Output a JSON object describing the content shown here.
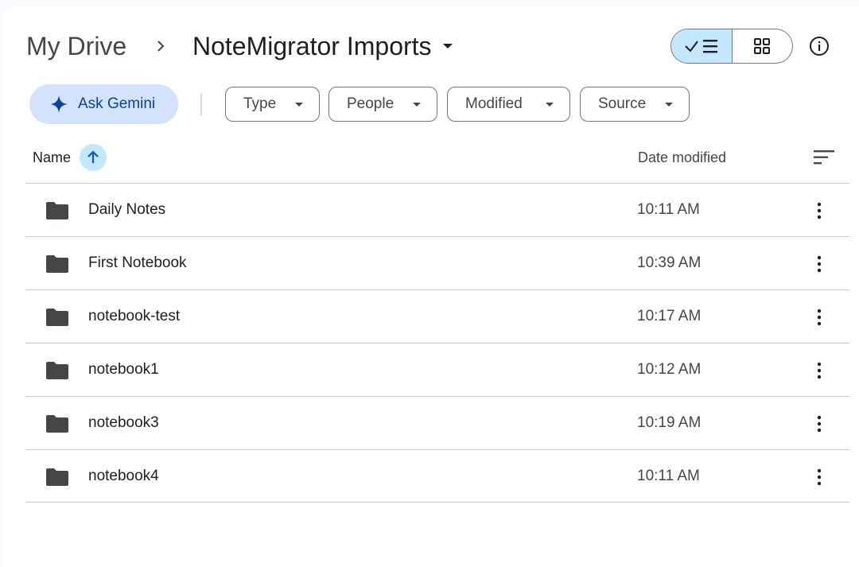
{
  "breadcrumb": {
    "root": "My Drive",
    "current": "NoteMigrator Imports"
  },
  "view_toggle": {
    "active": "list",
    "list_icon": "check-list-icon",
    "grid_icon": "grid-icon"
  },
  "info_icon": "info-icon",
  "gemini": {
    "label": "Ask Gemini",
    "icon": "sparkle-icon"
  },
  "filters": [
    {
      "label": "Type"
    },
    {
      "label": "People"
    },
    {
      "label": "Modified"
    },
    {
      "label": "Source"
    }
  ],
  "columns": {
    "name": "Name",
    "date_modified": "Date modified",
    "sort_direction": "ascending"
  },
  "files": [
    {
      "name": "Daily Notes",
      "date": "10:11 AM",
      "icon": "folder-icon"
    },
    {
      "name": "First Notebook",
      "date": "10:39 AM",
      "icon": "folder-icon"
    },
    {
      "name": "notebook-test",
      "date": "10:17 AM",
      "icon": "folder-icon"
    },
    {
      "name": "notebook1",
      "date": "10:12 AM",
      "icon": "folder-icon"
    },
    {
      "name": "notebook3",
      "date": "10:19 AM",
      "icon": "folder-icon"
    },
    {
      "name": "notebook4",
      "date": "10:11 AM",
      "icon": "folder-icon"
    }
  ],
  "colors": {
    "accent_light": "#c2e7ff",
    "gemini_bg": "#d3e3fd",
    "gemini_text": "#0842a0",
    "folder": "#444746"
  }
}
